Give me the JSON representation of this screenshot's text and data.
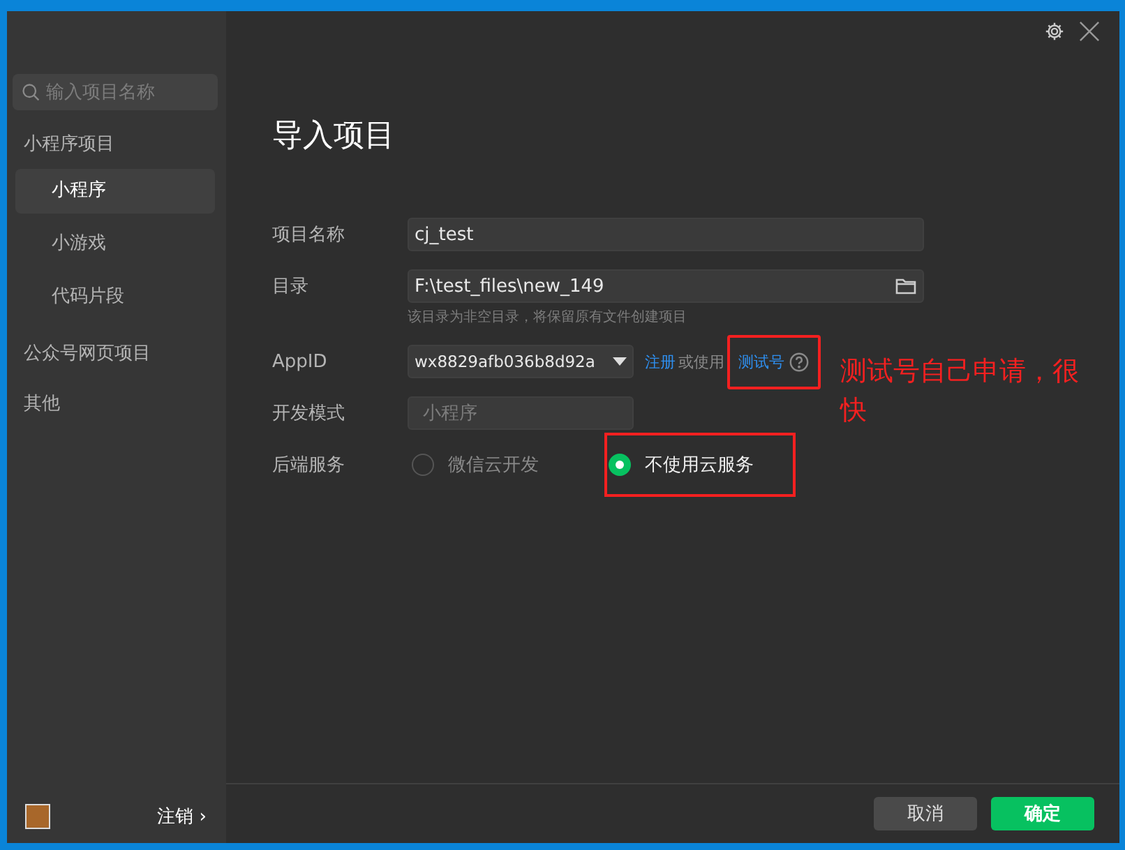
{
  "sidebar": {
    "search": {
      "placeholder": "输入项目名称"
    },
    "groups": [
      {
        "label": "小程序项目",
        "children": [
          {
            "label": "小程序",
            "selected": true
          },
          {
            "label": "小游戏",
            "selected": false
          },
          {
            "label": "代码片段",
            "selected": false
          }
        ]
      },
      {
        "label": "公众号网页项目"
      },
      {
        "label": "其他"
      }
    ],
    "logout": "注销 ›"
  },
  "main": {
    "title": "导入项目",
    "fields": [
      {
        "kind": "text",
        "label": "项目名称",
        "value": "cj_test"
      },
      {
        "kind": "folder",
        "label": "目录",
        "value": "F:\\test_files\\new_149",
        "hint": "该目录为非空目录，将保留原有文件创建项目"
      },
      {
        "kind": "select",
        "label": "AppID",
        "value": "wx8829afb036b8d92a",
        "register": "注册",
        "or": "或使用",
        "test": "测试号",
        "highlighted": true
      },
      {
        "kind": "readonly",
        "label": "开发模式",
        "value": "小程序"
      },
      {
        "kind": "radio",
        "label": "后端服务",
        "options": [
          {
            "label": "微信云开发",
            "selected": false,
            "highlighted": false
          },
          {
            "label": "不使用云服务",
            "selected": true,
            "highlighted": true
          }
        ]
      }
    ],
    "note": "测试号自己申请，很快",
    "buttons": [
      {
        "label": "取消",
        "kind": "secondary"
      },
      {
        "label": "确定",
        "kind": "primary"
      }
    ]
  }
}
